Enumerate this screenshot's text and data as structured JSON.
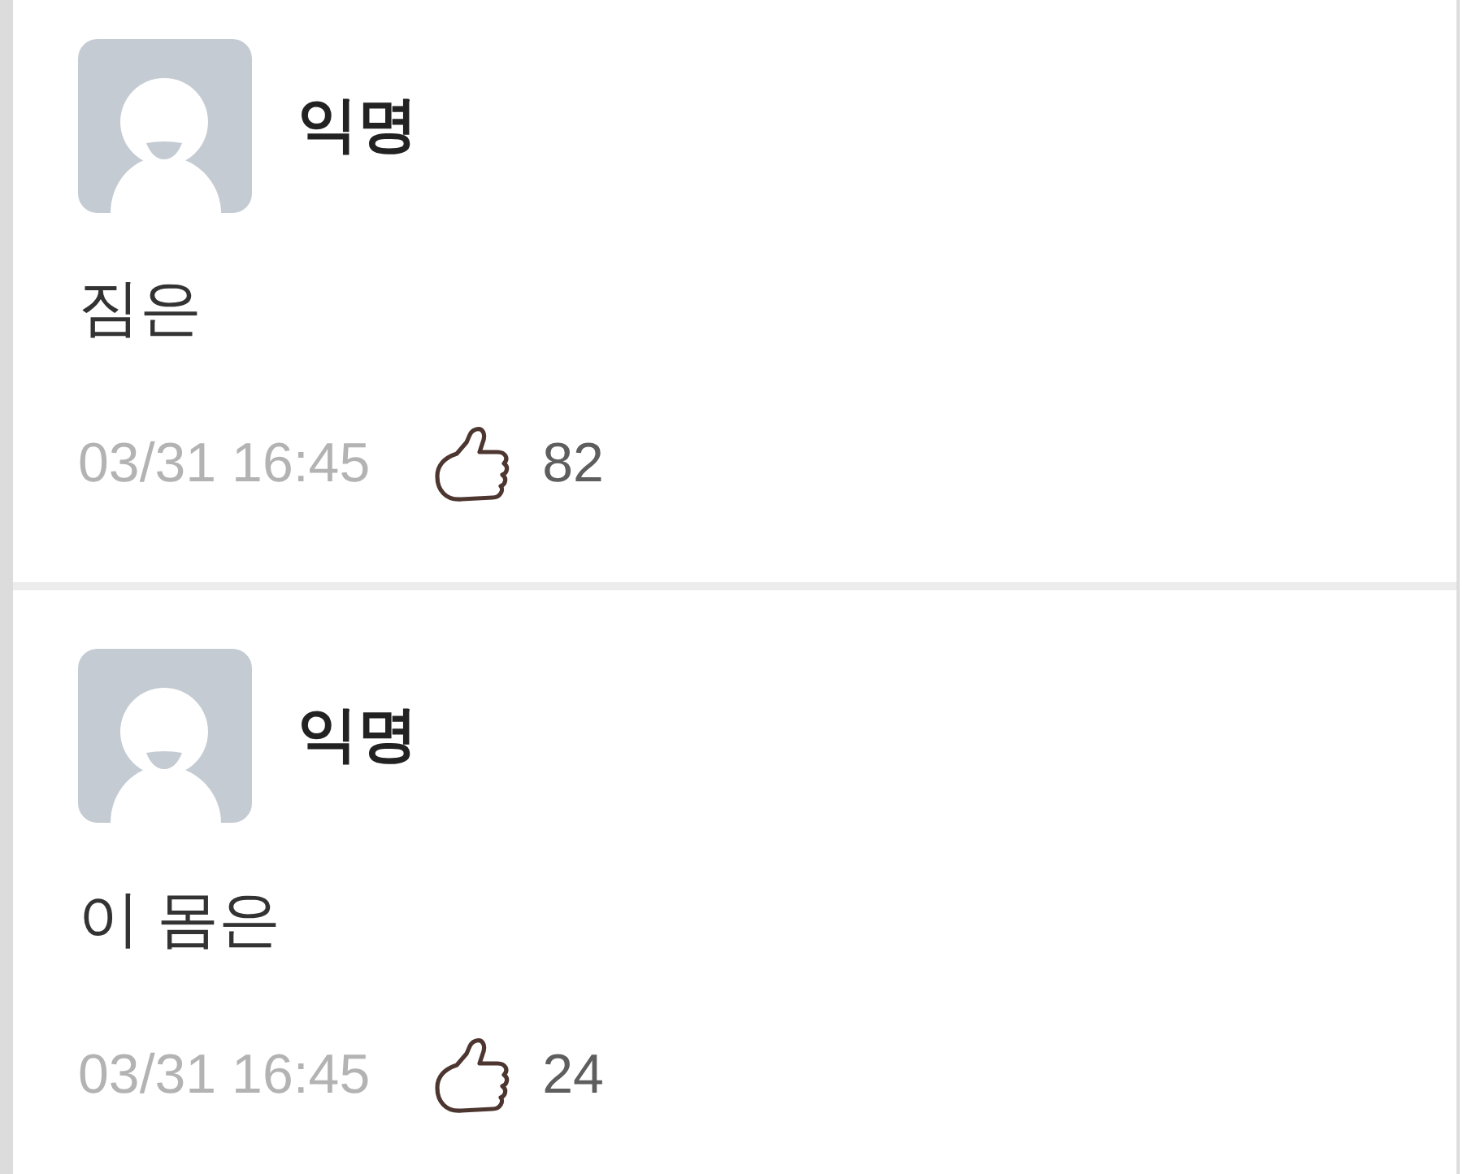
{
  "comments": [
    {
      "author": "익명",
      "text": "짐은",
      "time": "03/31 16:45",
      "likes": "82"
    },
    {
      "author": "익명",
      "text": "이 몸은",
      "time": "03/31 16:45",
      "likes": "24"
    }
  ]
}
